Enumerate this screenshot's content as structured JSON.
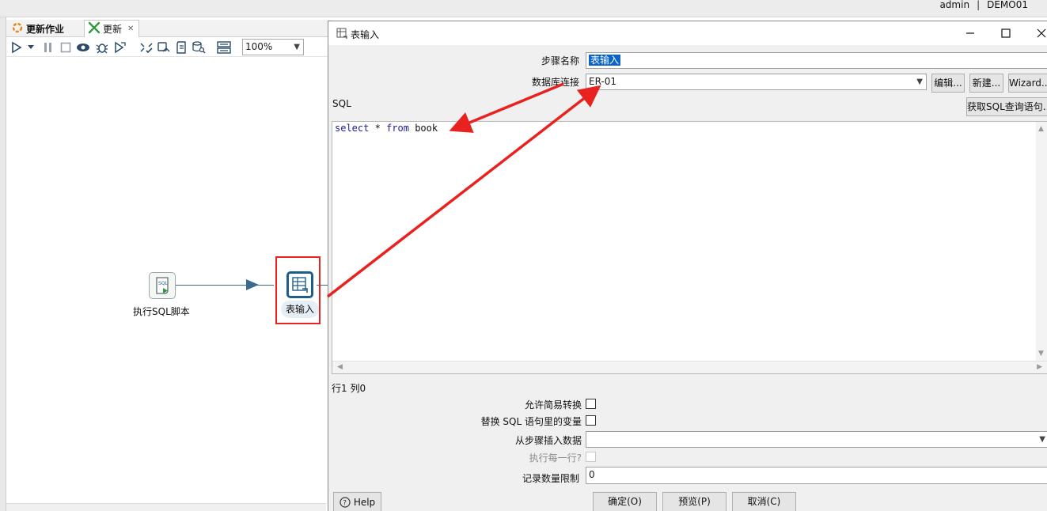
{
  "app": {
    "user": "admin",
    "repository": "DEMO01"
  },
  "editor": {
    "tabs": [
      {
        "label": "更新作业",
        "icon": "job-icon"
      },
      {
        "label": "更新",
        "icon": "transformation-icon"
      }
    ],
    "zoom": "100%",
    "steps": [
      {
        "label": "执行SQL脚本",
        "icon": "sql-script-icon"
      },
      {
        "label": "表输入",
        "icon": "table-input-icon"
      }
    ]
  },
  "dialog": {
    "title": "表输入",
    "step_name_label": "步骤名称",
    "step_name_value": "表输入",
    "db_connection_label": "数据库连接",
    "db_connection_value": "ER-01",
    "edit_button": "编辑...",
    "new_button": "新建...",
    "wizard_button": "Wizard...",
    "sql_label": "SQL",
    "get_sql_button": "获取SQL查询语句...",
    "sql": {
      "keyword_select": "select",
      "star": "*",
      "keyword_from": "from",
      "table": "book"
    },
    "cursor_position": "行1 列0",
    "lazy_conversion_label": "允许简易转换",
    "lazy_conversion_checked": false,
    "replace_variables_label": "替换 SQL 语句里的变量",
    "replace_variables_checked": false,
    "insert_from_step_label": "从步骤插入数据",
    "insert_from_step_value": "",
    "execute_each_row_label": "执行每一行?",
    "execute_each_row_checked": false,
    "limit_label": "记录数量限制",
    "limit_value": "0",
    "help_button": "Help",
    "ok_button": "确定(O)",
    "preview_button": "预览(P)",
    "cancel_button": "取消(C)"
  },
  "colors": {
    "highlight_red": "#e8231f",
    "step_border_blue": "#1d5d8c",
    "selection_blue": "#0a64c8"
  }
}
